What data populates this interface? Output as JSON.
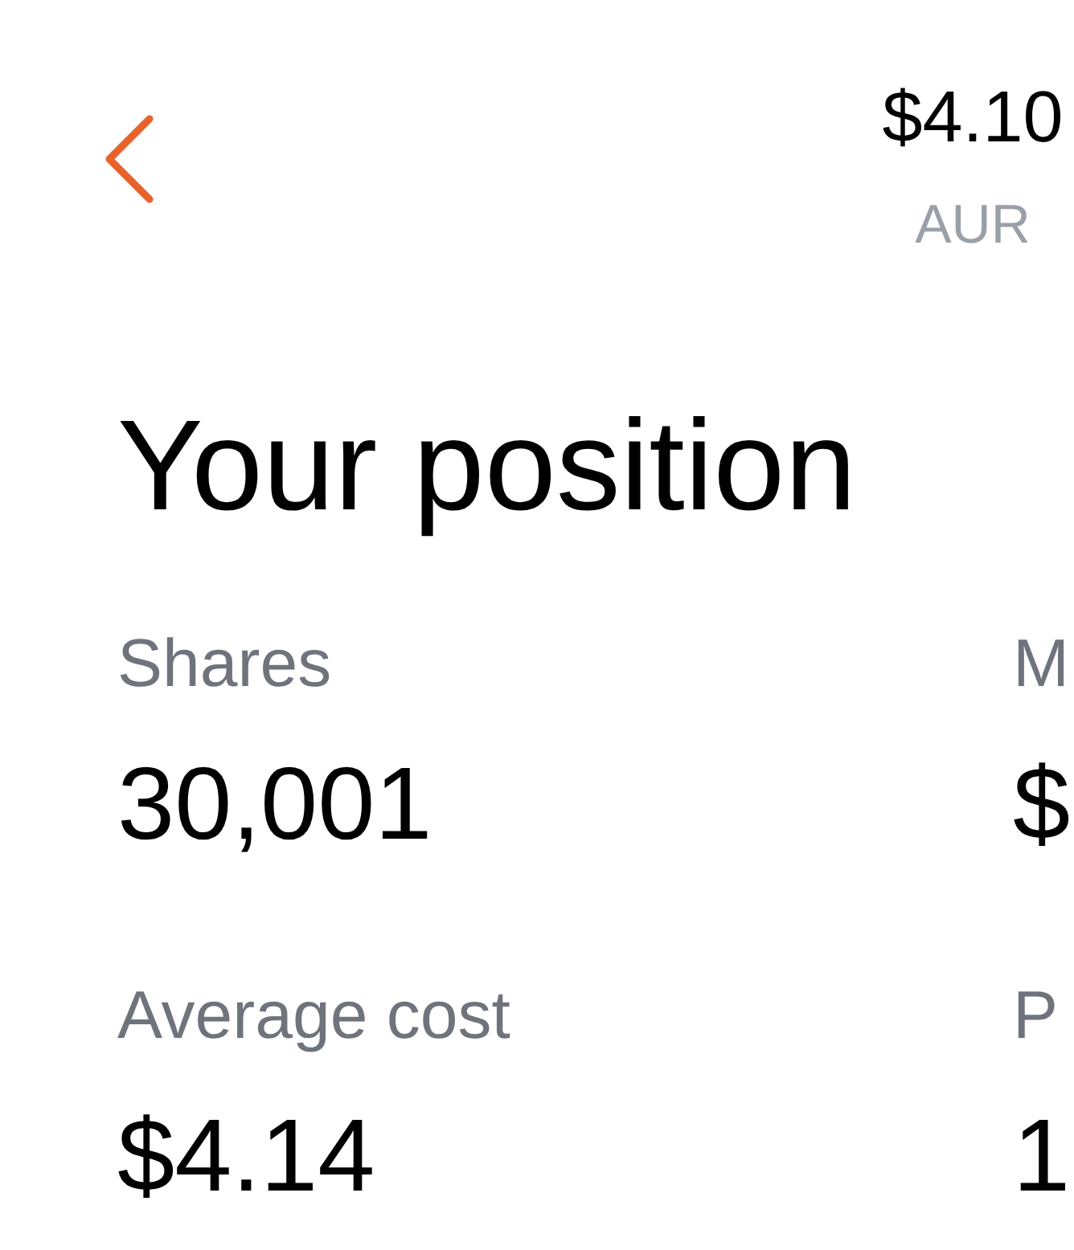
{
  "header": {
    "price": "$4.10",
    "ticker": "AUR"
  },
  "title": "Your position",
  "stats": [
    {
      "label": "Shares",
      "value": "30,001"
    },
    {
      "label": "M",
      "value": "$"
    },
    {
      "label": "Average cost",
      "value": "$4.14"
    },
    {
      "label": "P",
      "value": "1"
    }
  ]
}
